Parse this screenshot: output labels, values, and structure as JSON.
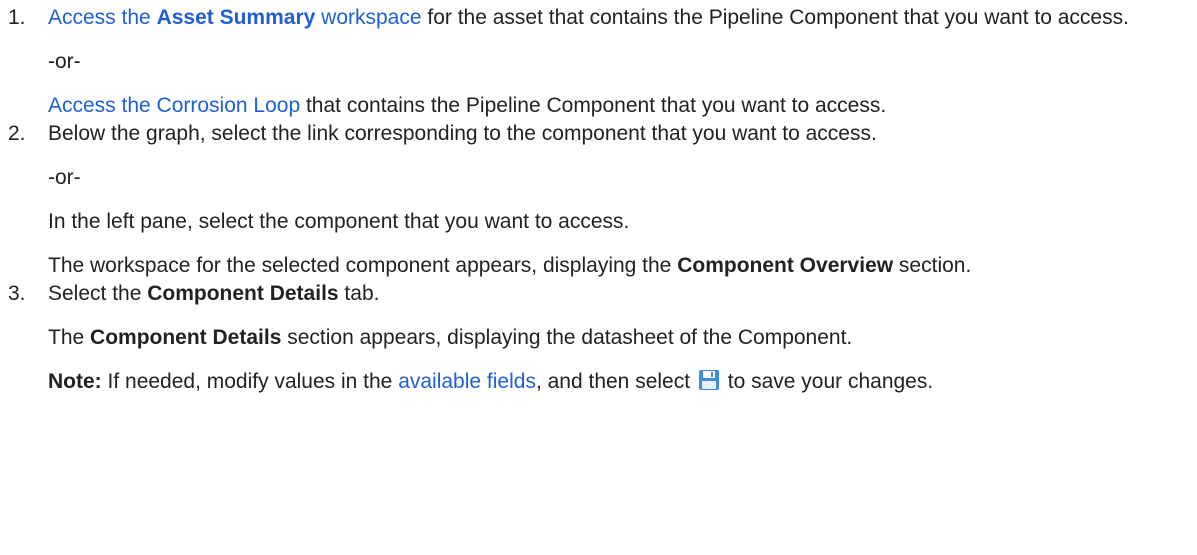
{
  "steps": [
    {
      "number": "1.",
      "line1": {
        "link_pre": "Access the ",
        "link_bold": "Asset Summary",
        "link_post": " workspace",
        "after": " for the asset that contains the Pipeline Component that you want to access."
      },
      "or": "-or-",
      "line2": {
        "link": "Access the Corrosion Loop",
        "after": " that contains the Pipeline Component that you want to access."
      }
    },
    {
      "number": "2.",
      "line1": "Below the graph, select the link corresponding to the component that you want to access.",
      "or": "-or-",
      "line2": "In the left pane, select the component that you want to access.",
      "result": {
        "pre": "The workspace for the selected component appears, displaying the ",
        "bold": "Component Overview",
        "post": " section."
      }
    },
    {
      "number": "3.",
      "line1": {
        "pre": "Select the ",
        "bold": "Component Details",
        "post": " tab."
      },
      "result": {
        "bold": "Component Details",
        "post": " section appears, displaying the datasheet of the Component.",
        "pre": "The "
      },
      "note": {
        "label": "Note:",
        "pre": " If needed, modify values in the ",
        "link": "available fields",
        "mid": ", and then select ",
        "icon": "save-icon",
        "post": " to save your changes."
      }
    }
  ],
  "colors": {
    "text": "#222222",
    "link": "#1f5fd6",
    "save_icon": "#3b8fe0"
  }
}
